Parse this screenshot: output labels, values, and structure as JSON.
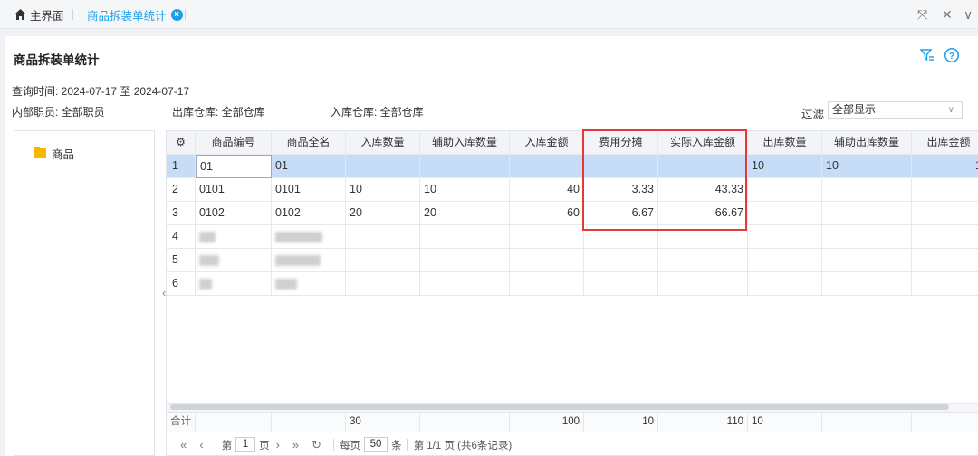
{
  "tabs": {
    "home": "主界面",
    "active": "商品拆装单统计"
  },
  "page": {
    "title": "商品拆装单统计",
    "query_time": "查询时间: 2024-07-17 至 2024-07-17",
    "staff": "内部职员: 全部职员",
    "out_warehouse": "出库仓库: 全部仓库",
    "in_warehouse": "入库仓库: 全部仓库",
    "filter_label": "过滤",
    "filter_value": "全部显示"
  },
  "tree": {
    "root": "商品"
  },
  "grid": {
    "headers": [
      "商品编号",
      "商品全名",
      "入库数量",
      "辅助入库数量",
      "入库金额",
      "费用分摊",
      "实际入库金额",
      "出库数量",
      "辅助出库数量",
      "出库金额"
    ],
    "rows": [
      {
        "n": "1",
        "code": "01",
        "name": "01",
        "in_qty": "",
        "aux_in": "",
        "in_amt": "",
        "fee": "",
        "real_in": "",
        "out_qty": "10",
        "aux_out": "10",
        "out_amt": "1"
      },
      {
        "n": "2",
        "code": "0101",
        "name": "0101",
        "in_qty": "10",
        "aux_in": "10",
        "in_amt": "40",
        "fee": "3.33",
        "real_in": "43.33",
        "out_qty": "",
        "aux_out": "",
        "out_amt": ""
      },
      {
        "n": "3",
        "code": "0102",
        "name": "0102",
        "in_qty": "20",
        "aux_in": "20",
        "in_amt": "60",
        "fee": "6.67",
        "real_in": "66.67",
        "out_qty": "",
        "aux_out": "",
        "out_amt": ""
      },
      {
        "n": "4",
        "code": "",
        "name": "",
        "in_qty": "",
        "aux_in": "",
        "in_amt": "",
        "fee": "",
        "real_in": "",
        "out_qty": "",
        "aux_out": "",
        "out_amt": ""
      },
      {
        "n": "5",
        "code": "",
        "name": "",
        "in_qty": "",
        "aux_in": "",
        "in_amt": "",
        "fee": "",
        "real_in": "",
        "out_qty": "",
        "aux_out": "",
        "out_amt": ""
      },
      {
        "n": "6",
        "code": "",
        "name": "",
        "in_qty": "",
        "aux_in": "",
        "in_amt": "",
        "fee": "",
        "real_in": "",
        "out_qty": "",
        "aux_out": "",
        "out_amt": ""
      }
    ],
    "summary": {
      "label": "合计",
      "in_qty": "30",
      "in_amt": "100",
      "fee": "10",
      "real_in": "110",
      "out_qty": "10"
    }
  },
  "pager": {
    "page_prefix": "第",
    "page_num": "1",
    "page_suffix": "页",
    "per_page_prefix": "每页",
    "per_page": "50",
    "per_page_suffix": "条",
    "summary": "第 1/1 页 (共6条记录)"
  },
  "colors": {
    "accent": "#1aa0e6",
    "selected_row": "#c7dcf7",
    "highlight_box": "#e53935"
  }
}
